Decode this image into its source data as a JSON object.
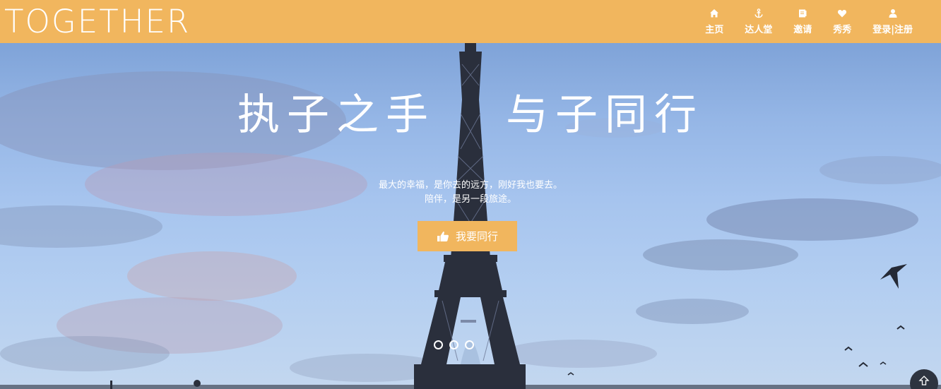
{
  "header": {
    "brand": "TOGETHER",
    "nav": [
      {
        "label": "主页",
        "icon": "home-icon"
      },
      {
        "label": "达人堂",
        "icon": "anchor-icon"
      },
      {
        "label": "邀请",
        "icon": "invite-icon"
      },
      {
        "label": "秀秀",
        "icon": "heart-icon"
      },
      {
        "label": "登录|注册",
        "icon": "user-icon"
      }
    ]
  },
  "hero": {
    "slogan_left": "执子之手",
    "slogan_right": "与子同行",
    "line1": "最大的幸福，是你去的远方，刚好我也要去。",
    "line2": "陪伴，是另一段旅途。",
    "cta_label": "我要同行",
    "cta_icon": "thumbs-up-icon",
    "carousel_dots": 3,
    "back_to_top_icon": "arrow-up-icon"
  },
  "colors": {
    "accent": "#f1b65e",
    "text_on_accent": "#ffffff"
  }
}
